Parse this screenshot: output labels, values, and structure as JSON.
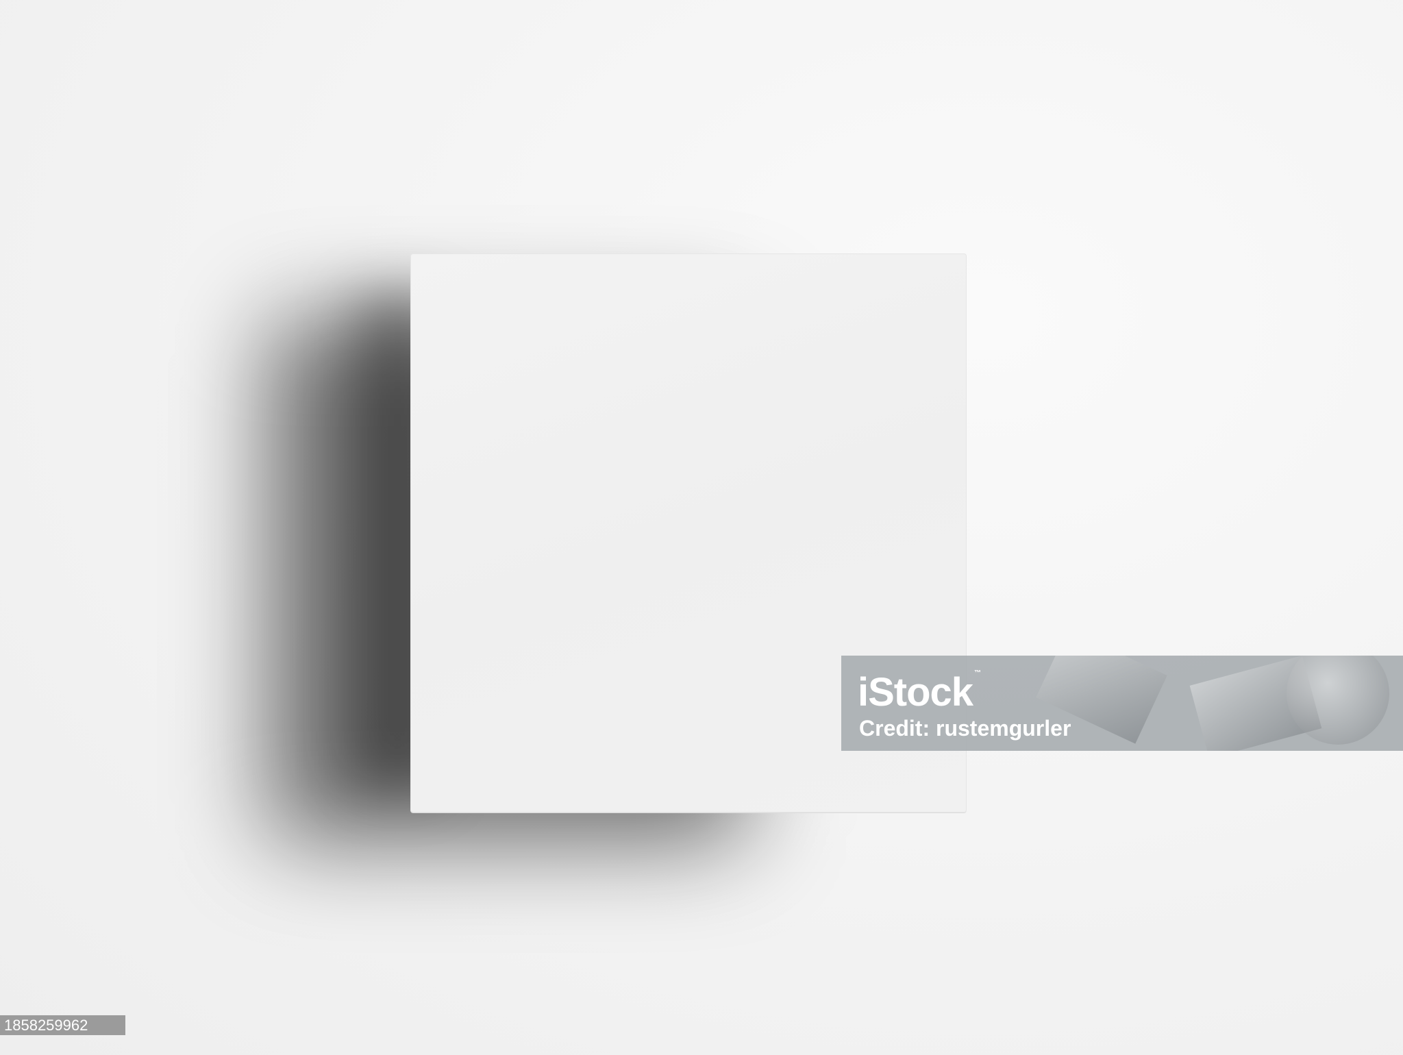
{
  "watermark": {
    "logo": "iStock",
    "trademark": "™",
    "credit": "Credit: rustemgurler"
  },
  "image_id": "1858259962"
}
